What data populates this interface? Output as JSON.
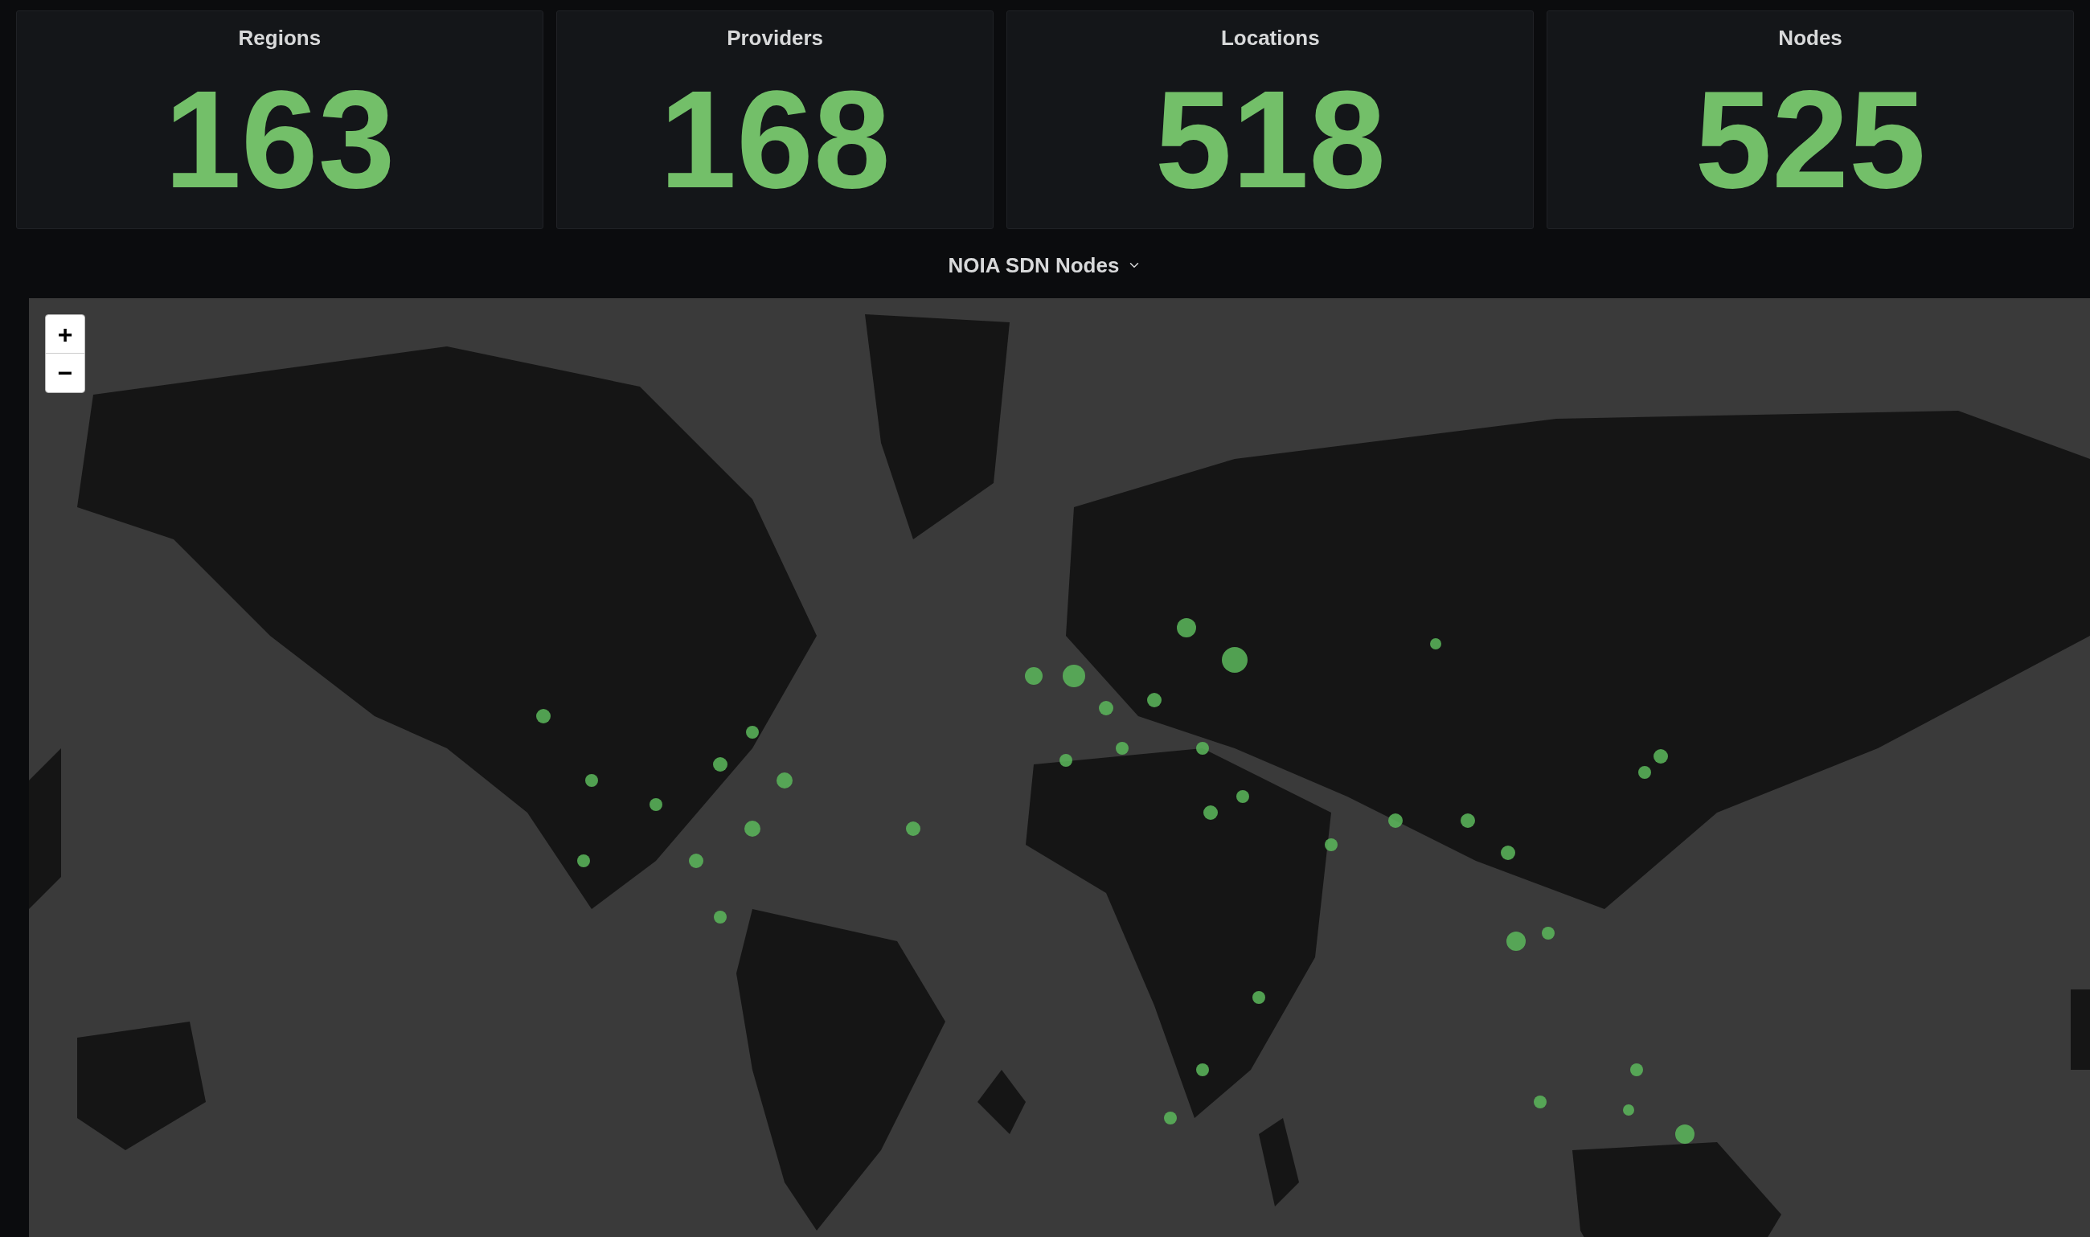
{
  "stats": [
    {
      "title": "Regions",
      "value": "163"
    },
    {
      "title": "Providers",
      "value": "168"
    },
    {
      "title": "Locations",
      "value": "518"
    },
    {
      "title": "Nodes",
      "value": "525"
    }
  ],
  "map_panel": {
    "title": "NOIA SDN Nodes",
    "zoom_in": "+",
    "zoom_out": "−"
  }
}
